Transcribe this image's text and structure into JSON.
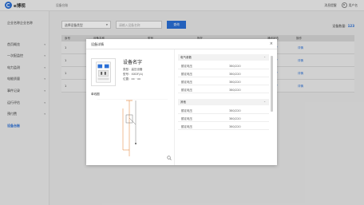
{
  "app": {
    "logo_text": "e博视",
    "breadcrumb": "设备台账"
  },
  "header": {
    "messages_label": "消息提醒",
    "user_label": "用户名"
  },
  "sidebar": {
    "company_name": "企业名称企业名称",
    "items": [
      {
        "label": "首页概览",
        "has_children": true,
        "active": false
      },
      {
        "label": "一次配监控",
        "has_children": true,
        "active": false
      },
      {
        "label": "电力监测",
        "has_children": true,
        "active": false
      },
      {
        "label": "电能质量",
        "has_children": true,
        "active": false
      },
      {
        "label": "事件记录",
        "has_children": true,
        "active": false
      },
      {
        "label": "运行评估",
        "has_children": true,
        "active": false
      },
      {
        "label": "预付费",
        "has_children": true,
        "active": false
      },
      {
        "label": "设备台账",
        "has_children": false,
        "active": true
      }
    ]
  },
  "filters": {
    "select_value": "选择设备类型",
    "search_placeholder": "请输入设备名称",
    "search_button": "查询"
  },
  "summary": {
    "count_label": "设备数量:",
    "count_value": "123"
  },
  "table": {
    "headers": [
      "序号",
      "设备名称",
      "型号",
      "所在",
      "通讯状态",
      "操作"
    ],
    "rows": [
      {
        "index": "1",
        "action": "详情"
      },
      {
        "index": "1",
        "action": "详情"
      },
      {
        "index": "1",
        "action": "详情"
      },
      {
        "index": "1",
        "action": "详情"
      }
    ]
  },
  "modal": {
    "title": "设备详情",
    "device_name": "设备名字",
    "attributes": [
      "类型：高压设备",
      "型号：XXDF(A)",
      "位置：xx · xx"
    ],
    "diagram_label": "单线图",
    "groups": [
      {
        "title": "电气参数",
        "rows": [
          {
            "key": "额定电压",
            "value": "380/220"
          },
          {
            "key": "额定电压",
            "value": "380/220"
          },
          {
            "key": "额定电压",
            "value": "380/220"
          },
          {
            "key": "额定电压",
            "value": "380/220"
          }
        ]
      },
      {
        "title": "其他",
        "rows": [
          {
            "key": "额定电压",
            "value": "380/220"
          },
          {
            "key": "额定电压",
            "value": "380/220"
          },
          {
            "key": "额定电压",
            "value": "380/220"
          }
        ]
      }
    ]
  },
  "colors": {
    "accent": "#2a6fd6",
    "overlay": "rgba(0,0,0,0.12)"
  },
  "icons": {
    "logo": "logo-icon",
    "user": "user-icon",
    "close": "close-icon",
    "zoom": "zoom-icon",
    "wifi": "wifi-icon",
    "chevron": "chevron-down-icon"
  }
}
